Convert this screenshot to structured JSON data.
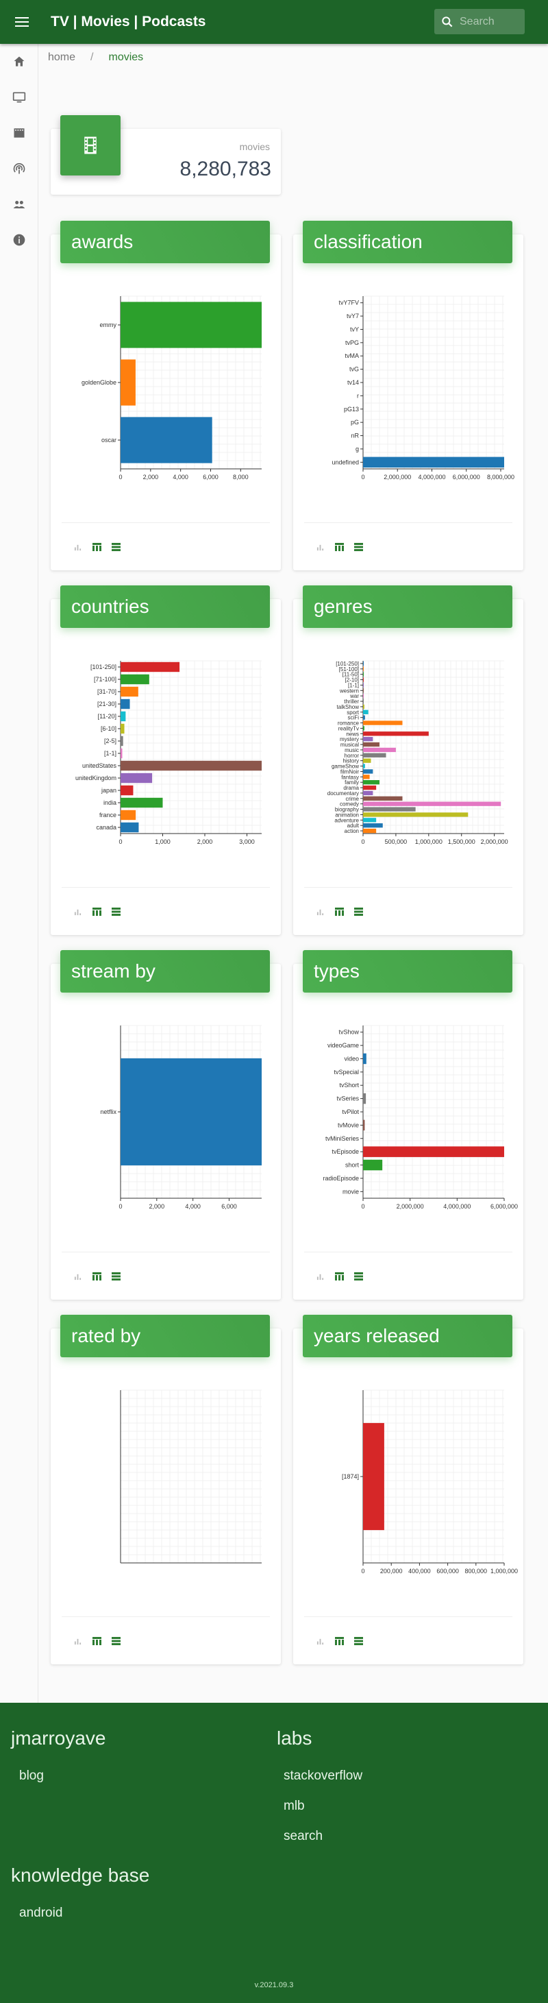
{
  "app": {
    "title": "TV | Movies | Podcasts"
  },
  "search": {
    "placeholder": "Search"
  },
  "nav": {
    "items": [
      "home-icon",
      "tv-icon",
      "movie-icon",
      "podcast-icon",
      "people-icon",
      "info-icon"
    ]
  },
  "breadcrumb": {
    "home": "home",
    "sep": "/",
    "current": "movies"
  },
  "stat": {
    "label": "movies",
    "value": "8,280,783",
    "icon": "film-icon"
  },
  "colors": {
    "brand": "#1d6428",
    "accent": "#43a047",
    "blue": "#1f77b4",
    "orange": "#ff7f0e",
    "green": "#2ca02c",
    "red": "#d62728",
    "purple": "#9467bd",
    "brown": "#8c564b",
    "pink": "#e377c2",
    "olive": "#bcbd22",
    "cyan": "#17becf",
    "gray": "#7f7f7f"
  },
  "cards": [
    {
      "title": "awards",
      "chart_data": {
        "type": "bar",
        "orientation": "horizontal",
        "categories": [
          "emmy",
          "goldenGlobe",
          "oscar"
        ],
        "values": [
          9400,
          1000,
          6100
        ],
        "colors": [
          "#2ca02c",
          "#ff7f0e",
          "#1f77b4"
        ],
        "xlim": [
          0,
          9400
        ],
        "ticks": [
          0,
          2000,
          4000,
          6000,
          8000
        ],
        "tick_labels": [
          "0",
          "2,000",
          "4,000",
          "6,000",
          "8,000"
        ]
      }
    },
    {
      "title": "classification",
      "chart_data": {
        "type": "bar",
        "orientation": "horizontal",
        "categories": [
          "tvY7FV",
          "tvY7",
          "tvY",
          "tvPG",
          "tvMA",
          "tvG",
          "tv14",
          "r",
          "pG13",
          "pG",
          "nR",
          "g",
          "undefined"
        ],
        "values": [
          0,
          0,
          0,
          0,
          0,
          0,
          0,
          0,
          0,
          0,
          0,
          0,
          8200000
        ],
        "colors": [
          "#1f77b4"
        ],
        "xlim": [
          0,
          8200000
        ],
        "ticks": [
          0,
          2000000,
          4000000,
          6000000,
          8000000
        ],
        "tick_labels": [
          "0",
          "2,000,000",
          "4,000,000",
          "6,000,000",
          "8,000,000"
        ]
      }
    },
    {
      "title": "countries",
      "chart_data": {
        "type": "bar",
        "orientation": "horizontal",
        "categories": [
          "[101-250]",
          "[71-100]",
          "[31-70]",
          "[21-30]",
          "[11-20]",
          "[6-10]",
          "[2-5]",
          "[1-1]",
          "unitedStates",
          "unitedKingdom",
          "japan",
          "india",
          "france",
          "canada"
        ],
        "values": [
          1400,
          680,
          420,
          220,
          120,
          90,
          60,
          40,
          3350,
          750,
          300,
          1000,
          360,
          430
        ],
        "colors": [
          "#d62728",
          "#2ca02c",
          "#ff7f0e",
          "#1f77b4",
          "#17becf",
          "#bcbd22",
          "#7f7f7f",
          "#e377c2",
          "#8c564b",
          "#9467bd",
          "#d62728",
          "#2ca02c",
          "#ff7f0e",
          "#1f77b4"
        ],
        "xlim": [
          0,
          3350
        ],
        "ticks": [
          0,
          1000,
          2000,
          3000
        ],
        "tick_labels": [
          "0",
          "1,000",
          "2,000",
          "3,000"
        ]
      }
    },
    {
      "title": "genres",
      "chart_data": {
        "type": "bar",
        "orientation": "horizontal",
        "categories": [
          "[101-250]",
          "[51-100]",
          "[11-50]",
          "[2-10]",
          "[1-1]",
          "western",
          "war",
          "thriller",
          "talkShow",
          "sport",
          "sciFi",
          "romance",
          "realityTv",
          "news",
          "mystery",
          "musical",
          "music",
          "horror",
          "history",
          "gameShow",
          "filmNoir",
          "fantasy",
          "family",
          "drama",
          "documentary",
          "crime",
          "comedy",
          "biography",
          "animation",
          "adventure",
          "adult",
          "action"
        ],
        "values": [
          3000,
          3000,
          3000,
          3000,
          3000,
          3000,
          3000,
          3000,
          20000,
          80000,
          30000,
          600000,
          20000,
          1000000,
          150000,
          250000,
          500000,
          350000,
          120000,
          30000,
          150000,
          100000,
          250000,
          200000,
          150000,
          600000,
          2100000,
          800000,
          1600000,
          200000,
          300000,
          200000
        ],
        "colors": [
          "#1f77b4",
          "#ff7f0e",
          "#2ca02c",
          "#d62728",
          "#9467bd",
          "#8c564b",
          "#e377c2",
          "#7f7f7f",
          "#bcbd22",
          "#17becf"
        ],
        "xlim": [
          0,
          2150000
        ],
        "ticks": [
          0,
          500000,
          1000000,
          1500000,
          2000000
        ],
        "tick_labels": [
          "0",
          "500,000",
          "1,000,000",
          "1,500,000",
          "2,000,000"
        ]
      }
    },
    {
      "title": "stream by",
      "chart_data": {
        "type": "bar",
        "orientation": "horizontal",
        "categories": [
          "netflix"
        ],
        "values": [
          7800
        ],
        "colors": [
          "#1f77b4"
        ],
        "xlim": [
          0,
          7800
        ],
        "ticks": [
          0,
          2000,
          4000,
          6000
        ],
        "tick_labels": [
          "0",
          "2,000",
          "4,000",
          "6,000"
        ]
      }
    },
    {
      "title": "types",
      "chart_data": {
        "type": "bar",
        "orientation": "horizontal",
        "categories": [
          "tvShow",
          "videoGame",
          "video",
          "tvSpecial",
          "tvShort",
          "tvSeries",
          "tvPilot",
          "tvMovie",
          "tvMiniSeries",
          "tvEpisode",
          "short",
          "radioEpisode",
          "movie"
        ],
        "values": [
          0,
          0,
          140000,
          0,
          0,
          120000,
          0,
          70000,
          0,
          6000000,
          820000,
          0,
          0
        ],
        "colors": [
          "#1f77b4",
          "#ff7f0e",
          "#1f77b4",
          "#2ca02c",
          "#d62728",
          "#7f7f7f",
          "#8c564b",
          "#8c564b",
          "#e377c2",
          "#d62728",
          "#2ca02c",
          "#ff7f0e",
          "#1f77b4"
        ],
        "xlim": [
          0,
          6000000
        ],
        "ticks": [
          0,
          2000000,
          4000000,
          6000000
        ],
        "tick_labels": [
          "0",
          "2,000,000",
          "4,000,000",
          "6,000,000"
        ]
      }
    },
    {
      "title": "rated by",
      "chart_data": {
        "type": "bar",
        "orientation": "horizontal",
        "categories": [],
        "values": [],
        "colors": [],
        "xlim": [
          0,
          1
        ],
        "ticks": [],
        "tick_labels": []
      }
    },
    {
      "title": "years released",
      "chart_data": {
        "type": "bar",
        "orientation": "horizontal",
        "categories": [
          "[1874]"
        ],
        "values": [
          150000
        ],
        "colors": [
          "#d62728"
        ],
        "xlim": [
          0,
          1000000
        ],
        "ticks": [
          0,
          200000,
          400000,
          600000,
          800000,
          1000000
        ],
        "tick_labels": [
          "0",
          "200,000",
          "400,000",
          "600,000",
          "800,000",
          "1,000,000"
        ]
      }
    }
  ],
  "card_actions": {
    "chart": "bar-chart-icon",
    "table": "table-icon",
    "list": "list-icon"
  },
  "footer": {
    "sections": [
      {
        "title": "jmarroyave",
        "links": [
          "blog"
        ]
      },
      {
        "title": "labs",
        "links": [
          "stackoverflow",
          "mlb",
          "search"
        ]
      },
      {
        "title": "knowledge base",
        "links": [
          "android"
        ]
      }
    ],
    "version": "v.2021.09.3"
  }
}
